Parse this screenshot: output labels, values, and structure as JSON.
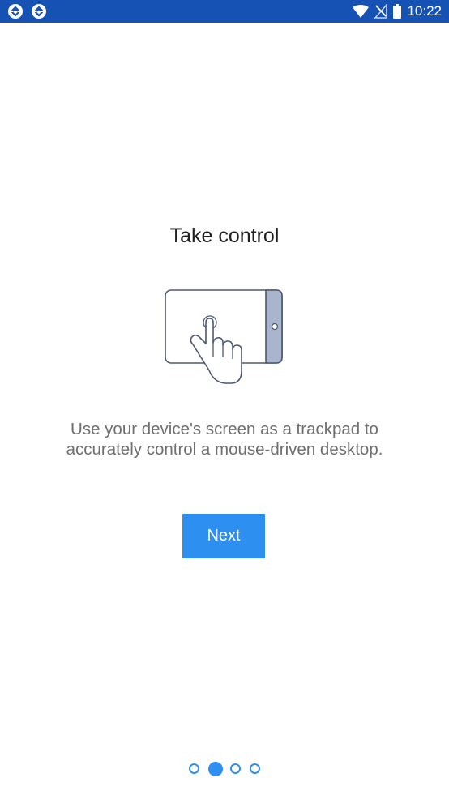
{
  "status_bar": {
    "time": "10:22",
    "icons": [
      "app-notification-icon",
      "app-notification-icon",
      "wifi-icon",
      "no-signal-icon",
      "battery-icon"
    ],
    "background_color": "#1552b3"
  },
  "onboarding": {
    "title": "Take control",
    "illustration": "tablet-touch-hand-icon",
    "description": "Use your device's screen as a trackpad to accurately control a mouse-driven desktop.",
    "next_label": "Next",
    "accent_color": "#2d8ff0"
  },
  "pager": {
    "total_pages": 4,
    "current_page": 2
  }
}
